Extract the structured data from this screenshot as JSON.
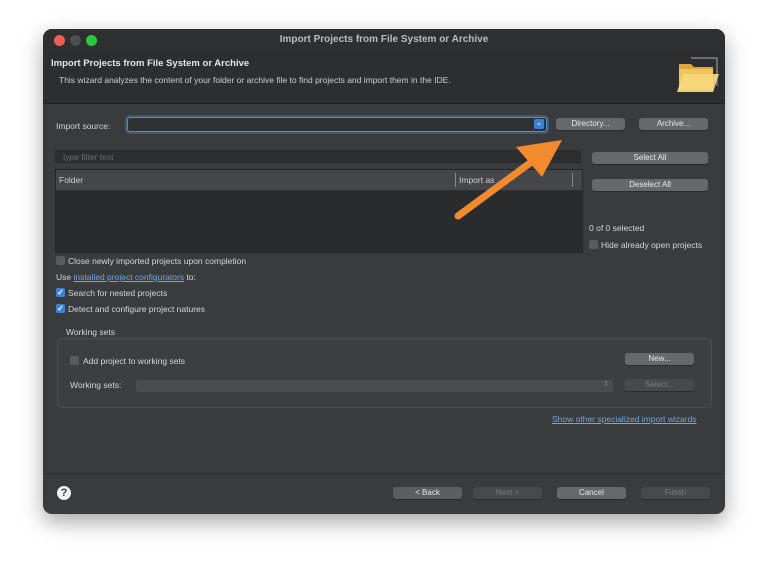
{
  "window": {
    "title": "Import Projects from File System or Archive"
  },
  "header": {
    "title": "Import Projects from File System or Archive",
    "description": "This wizard analyzes the content of your folder or archive file to find projects and import them in the IDE."
  },
  "import_source": {
    "label": "Import source:",
    "value": "",
    "directory_button": "Directory...",
    "archive_button": "Archive..."
  },
  "filter": {
    "placeholder": "type filter text"
  },
  "table": {
    "columns": [
      "Folder",
      "Import as"
    ]
  },
  "side": {
    "select_all": "Select All",
    "deselect_all": "Deselect All",
    "selected_count": "0 of 0 selected",
    "hide_open_label": "Hide already open projects",
    "hide_open_checked": false
  },
  "options": {
    "close_label": "Close newly imported projects upon completion",
    "close_checked": false,
    "use_prefix": "Use",
    "configurators_link": "installed project configurators",
    "use_suffix": "to:",
    "nested_label": "Search for nested projects",
    "nested_checked": true,
    "detect_label": "Detect and configure project natures",
    "detect_checked": true
  },
  "working_sets": {
    "group_label": "Working sets",
    "add_label": "Add project to working sets",
    "add_checked": false,
    "new_button": "New...",
    "sets_label": "Working sets:",
    "select_button": "Select..."
  },
  "specialized_link": "Show other specialized import wizards",
  "footer": {
    "help": "?",
    "back": "< Back",
    "next": "Next >",
    "cancel": "Cancel",
    "finish": "Finish"
  },
  "colors": {
    "window_bg": "#3a3b3d",
    "accent": "#3a83d8",
    "annotation_arrow": "#f28a2e"
  },
  "icons": {
    "header_icon": "folder-icon",
    "combo_arrow": "chevron-down-icon",
    "annotation": "orange-arrow-icon"
  }
}
